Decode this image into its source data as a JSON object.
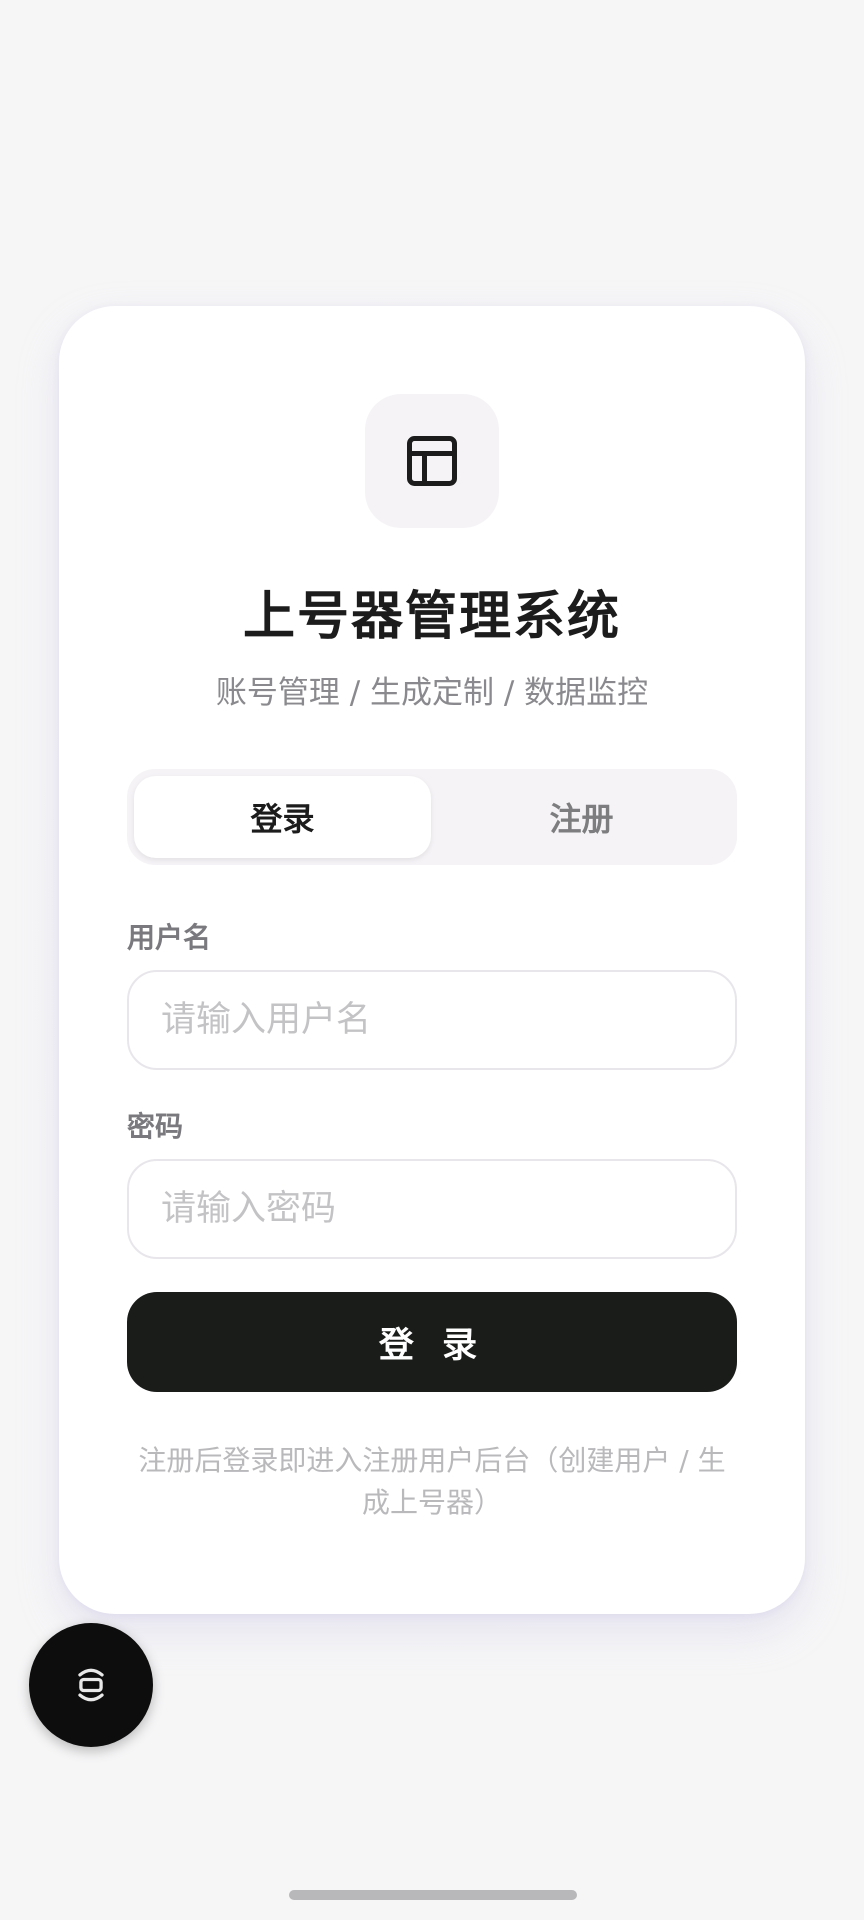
{
  "app": {
    "title": "上号器管理系统",
    "subtitle": "账号管理 / 生成定制 / 数据监控",
    "logo_icon": "layout-panel-icon"
  },
  "tabs": [
    {
      "label": "登录",
      "active": true
    },
    {
      "label": "注册",
      "active": false
    }
  ],
  "form": {
    "username": {
      "label": "用户名",
      "placeholder": "请输入用户名",
      "value": ""
    },
    "password": {
      "label": "密码",
      "placeholder": "请输入密码",
      "value": ""
    },
    "submit_label": "登 录"
  },
  "hint": "注册后登录即进入注册用户后台（创建用户 / 生成上号器）",
  "floating_button": {
    "icon": "scan-toggle-icon"
  },
  "colors": {
    "background": "#f6f6f7",
    "card": "#ffffff",
    "primary_button": "#1a1c1a",
    "title_text": "#1b1c1b",
    "muted_text": "#8a8a8e"
  }
}
